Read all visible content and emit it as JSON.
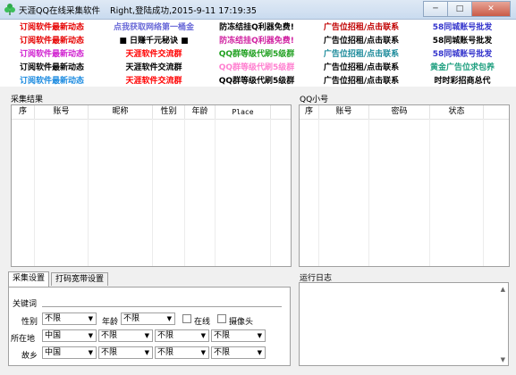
{
  "window": {
    "title": "天涯QQ在线采集软件",
    "status": "Right,登陆成功,2015-9-11 17:19:35",
    "minimize": "─",
    "maximize": "□",
    "close": "✕"
  },
  "ads": [
    [
      {
        "text": "订阅软件最新动态",
        "color": "#e60000"
      },
      {
        "text": "点我获取网络第一桶金",
        "color": "#6a6ad8"
      },
      {
        "text": "防冻结挂Q利器免费!",
        "color": "#000000"
      },
      {
        "text": "广告位招租/点击联系",
        "color": "#c00000"
      },
      {
        "text": "58同城账号批发",
        "color": "#3333cc"
      }
    ],
    [
      {
        "text": "订阅软件最新动态",
        "color": "#e60000"
      },
      {
        "text": "■ 日赚千元秘诀 ■",
        "color": "#000000"
      },
      {
        "text": "防冻结挂Q利器免费!",
        "color": "#d020a0"
      },
      {
        "text": "广告位招租/点击联系",
        "color": "#000000"
      },
      {
        "text": "58同城账号批发",
        "color": "#000000"
      }
    ],
    [
      {
        "text": "订阅软件最新动态",
        "color": "#d020d0"
      },
      {
        "text": "天涯软件交流群",
        "color": "#ff0000"
      },
      {
        "text": "QQ群等级代刷5级群",
        "color": "#20a020"
      },
      {
        "text": "广告位招租/点击联系",
        "color": "#1a8a9a"
      },
      {
        "text": "58同城账号批发",
        "color": "#3333cc"
      }
    ],
    [
      {
        "text": "订阅软件最新动态",
        "color": "#000000"
      },
      {
        "text": "天涯软件交流群",
        "color": "#000000"
      },
      {
        "text": "QQ群等级代刷5级群",
        "color": "#ff80d0"
      },
      {
        "text": "广告位招租/点击联系",
        "color": "#000000"
      },
      {
        "text": "黄金广告位求包养",
        "color": "#20a080"
      }
    ],
    [
      {
        "text": "订阅软件最新动态",
        "color": "#1a8ae0"
      },
      {
        "text": "天涯软件交流群",
        "color": "#ff0000"
      },
      {
        "text": "QQ群等级代刷5级群",
        "color": "#000000"
      },
      {
        "text": "广告位招租/点击联系",
        "color": "#000000"
      },
      {
        "text": "时时彩招商总代",
        "color": "#000000"
      }
    ]
  ],
  "results": {
    "label": "采集结果",
    "columns": [
      "序",
      "账号",
      "昵称",
      "性别",
      "年龄",
      "Place"
    ]
  },
  "qq": {
    "label": "QQ小号",
    "columns": [
      "序",
      "账号",
      "密码",
      "状态"
    ]
  },
  "tabs": [
    "采集设置",
    "打码宽带设置"
  ],
  "settings": {
    "keyword_label": "关键词",
    "keyword_value": "",
    "gender_label": "性别",
    "gender_value": "不限",
    "age_label": "年龄",
    "age_value": "不限",
    "online_label": "在线",
    "camera_label": "摄像头",
    "location_label": "所在地",
    "location_values": [
      "中国",
      "不限",
      "不限",
      "不限"
    ],
    "hometown_label": "故乡",
    "hometown_values": [
      "中国",
      "不限",
      "不限",
      "不限"
    ]
  },
  "log": {
    "label": "运行日志"
  },
  "icons": {
    "logo": "green-clover-icon",
    "dropdown": "chevron-down-icon"
  }
}
